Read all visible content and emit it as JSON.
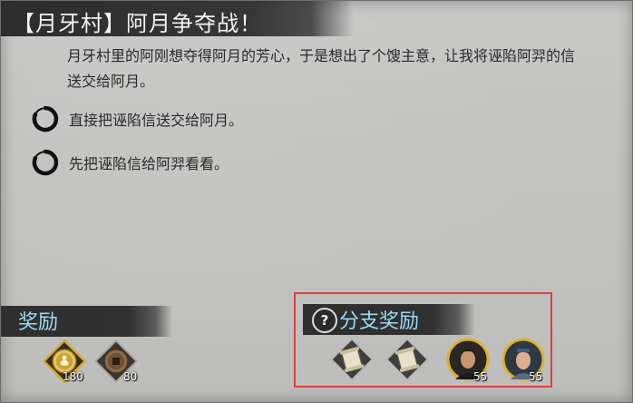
{
  "title": "【月牙村】阿月争夺战！",
  "description": "月牙村里的阿刚想夺得阿月的芳心，于是想出了个馊主意，让我将诬陷阿羿的信送交给阿月。",
  "options": [
    {
      "label": "直接把诬陷信送交给阿月。"
    },
    {
      "label": "先把诬陷信给阿羿看看。"
    }
  ],
  "rewards": {
    "title": "奖励",
    "items": [
      {
        "icon": "gold-coin-icon",
        "count": "180"
      },
      {
        "icon": "bronze-coin-icon",
        "count": "80"
      }
    ]
  },
  "branch_rewards": {
    "title": "分支奖励",
    "help_icon": "question-icon",
    "help_glyph": "?",
    "items": [
      {
        "icon": "scroll-icon",
        "count": ""
      },
      {
        "icon": "scroll-icon",
        "count": ""
      },
      {
        "icon": "male-character-portrait-icon",
        "count": "55"
      },
      {
        "icon": "female-character-portrait-icon",
        "count": "55"
      }
    ]
  },
  "colors": {
    "accent_text": "#9fd8f3",
    "highlight_border": "#e0403f",
    "gold_frame": "#d9a928"
  }
}
